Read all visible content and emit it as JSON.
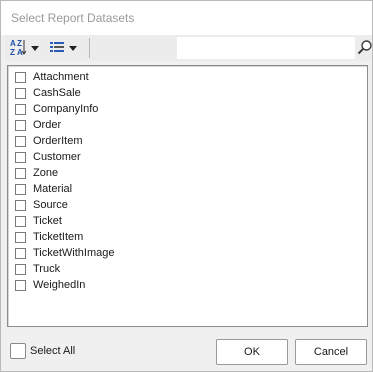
{
  "window": {
    "title": "Select Report Datasets"
  },
  "toolbar": {
    "sort_icon": "sort-az-icon",
    "view_icon": "list-view-icon",
    "search": {
      "value": "",
      "placeholder": ""
    },
    "search_icon": "magnifier-icon"
  },
  "list": {
    "items": [
      {
        "label": "Attachment",
        "checked": false
      },
      {
        "label": "CashSale",
        "checked": false
      },
      {
        "label": "CompanyInfo",
        "checked": false
      },
      {
        "label": "Order",
        "checked": false
      },
      {
        "label": "OrderItem",
        "checked": false
      },
      {
        "label": "Customer",
        "checked": false
      },
      {
        "label": "Zone",
        "checked": false
      },
      {
        "label": "Material",
        "checked": false
      },
      {
        "label": "Source",
        "checked": false
      },
      {
        "label": "Ticket",
        "checked": false
      },
      {
        "label": "TicketItem",
        "checked": false
      },
      {
        "label": "TicketWithImage",
        "checked": false
      },
      {
        "label": "Truck",
        "checked": false
      },
      {
        "label": "WeighedIn",
        "checked": false
      }
    ]
  },
  "footer": {
    "select_all_label": "Select All",
    "select_all_checked": false,
    "ok_label": "OK",
    "cancel_label": "Cancel"
  },
  "colors": {
    "title_text": "#9a9a9a",
    "dialog_bg": "#f0f0f0",
    "list_border": "#8c8c8c",
    "sort_icon_blue": "#1f4fa8",
    "list_icon_blue": "#2a5bb5"
  }
}
